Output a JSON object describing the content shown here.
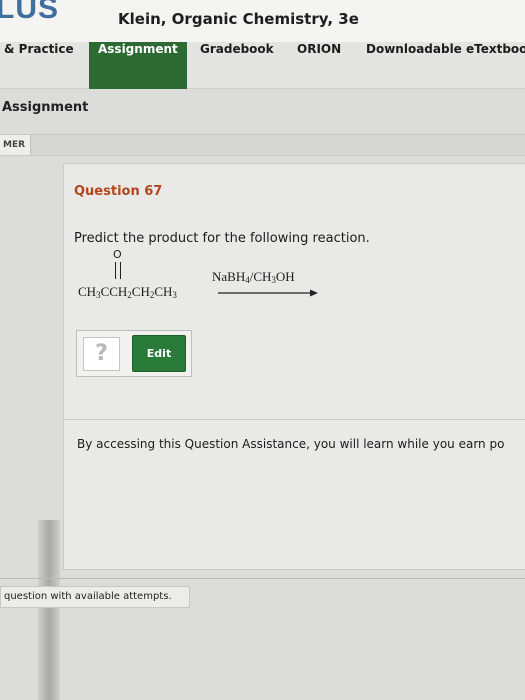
{
  "header": {
    "logo_text": "LUS",
    "book_title": "Klein, Organic Chemistry, 3e"
  },
  "nav": {
    "items": [
      {
        "label": "& Practice"
      },
      {
        "label": "Assignment",
        "active": true
      },
      {
        "label": "Gradebook"
      },
      {
        "label": "ORION"
      },
      {
        "label": "Downloadable eTextboo"
      }
    ]
  },
  "section_title": "Assignment",
  "tab_label": "MER",
  "question": {
    "title": "Question 67",
    "prompt": "Predict the product for the following reaction.",
    "reaction": {
      "carbonyl_o": "O",
      "formula_parts": [
        "CH",
        "3",
        "CCH",
        "2",
        "CH",
        "2",
        "CH",
        "3"
      ],
      "reagent_parts": [
        "NaBH",
        "4",
        "/CH",
        "3",
        "OH"
      ]
    },
    "answer_placeholder": "?",
    "edit_label": "Edit"
  },
  "assistance_text": "By accessing this Question Assistance, you will learn while you earn po",
  "footer_text": "question with available attempts.",
  "colors": {
    "accent_green": "#2d6a34",
    "question_title": "#b4461a",
    "logo_blue": "#3f6f9e"
  },
  "icons": {
    "answer_placeholder_icon": "question-mark-icon",
    "reaction_arrow_icon": "right-arrow-icon"
  }
}
